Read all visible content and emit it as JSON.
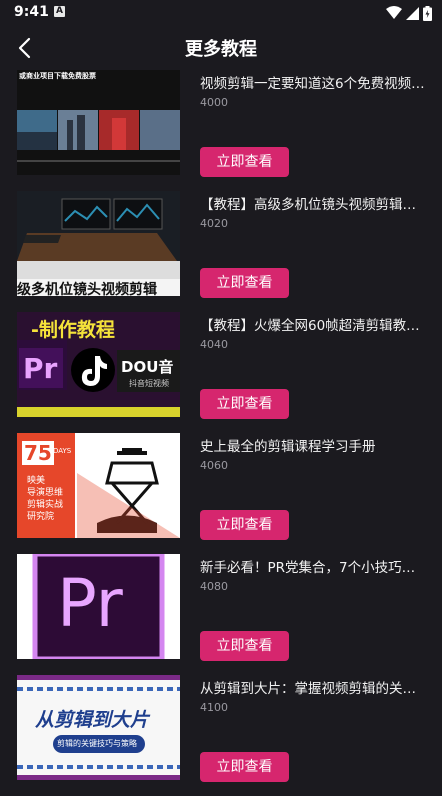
{
  "status_bar": {
    "time": "9:41",
    "notification_letter": "A",
    "icons": [
      "wifi-icon",
      "signal-icon",
      "battery-icon"
    ]
  },
  "header": {
    "title": "更多教程",
    "back_icon": "chevron-left-icon"
  },
  "accent_color": "#d6266e",
  "items": [
    {
      "title": "视频剪辑一定要知道这6个免费视频…",
      "count": "4000",
      "button_label": "立即查看",
      "thumb_text": "或商业项目下载免费股票"
    },
    {
      "title": "【教程】高级多机位镜头视频剪辑…",
      "count": "4020",
      "button_label": "立即查看",
      "thumb_text": "级多机位镜头视频剪辑"
    },
    {
      "title": "【教程】火爆全网60帧超清剪辑教…",
      "count": "4040",
      "button_label": "立即查看",
      "thumb_text": "-制作教程",
      "thumb_logo_a": "Pr",
      "thumb_logo_b": "DOU音",
      "thumb_logo_c": "抖音短视频"
    },
    {
      "title": "史上最全的剪辑课程学习手册",
      "count": "4060",
      "button_label": "立即查看",
      "thumb_number": "75",
      "thumb_days": "DAYS",
      "thumb_lines": [
        "映美",
        "导演思维",
        "剪辑实战",
        "研究院"
      ]
    },
    {
      "title": "新手必看！PR党集合，7个小技巧…",
      "count": "4080",
      "button_label": "立即查看",
      "thumb_logo": "Pr"
    },
    {
      "title": "从剪辑到大片：掌握视频剪辑的关…",
      "count": "4100",
      "button_label": "立即查看",
      "thumb_heading": "从剪辑到大片",
      "thumb_sub": "剪辑的关键技巧与策略"
    }
  ]
}
